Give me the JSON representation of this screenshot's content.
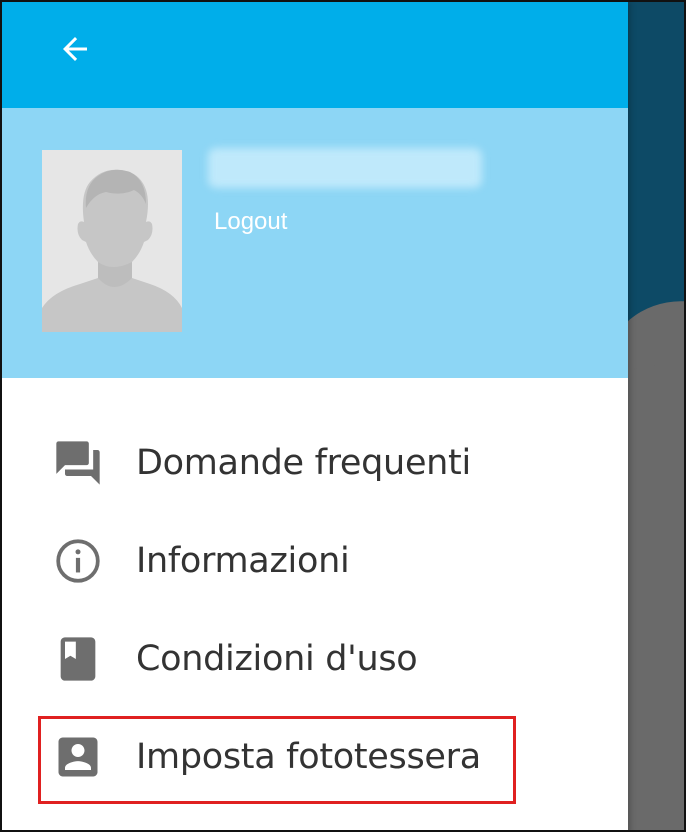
{
  "appbar": {
    "back_icon": "arrow-left-icon",
    "background": "#00aeea"
  },
  "header": {
    "background": "#8dd6f5",
    "username_hidden": "",
    "logout_label": "Logout"
  },
  "menu": {
    "items": [
      {
        "label": "Domande frequenti",
        "icon": "forum-icon"
      },
      {
        "label": "Informazioni",
        "icon": "info-icon"
      },
      {
        "label": "Condizioni d'uso",
        "icon": "book-icon"
      },
      {
        "label": "Imposta fototessera",
        "icon": "account-box-icon"
      }
    ]
  },
  "highlight_color": "#e02020"
}
